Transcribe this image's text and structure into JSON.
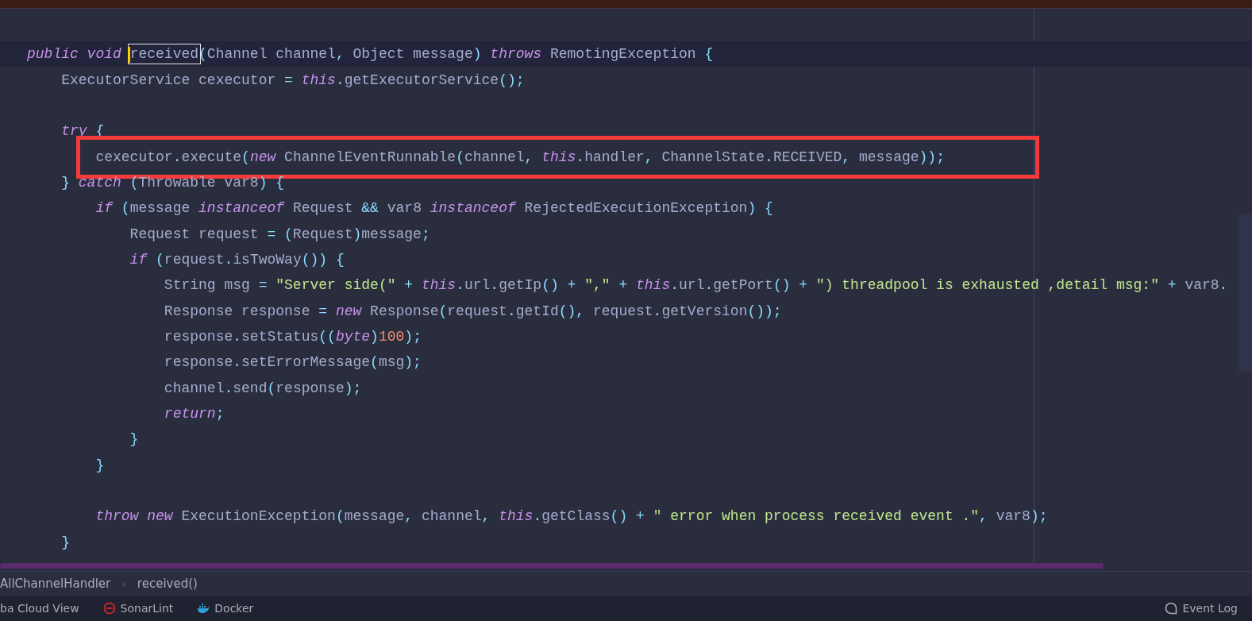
{
  "editor": {
    "lines": [
      {
        "current": true,
        "tokens": [
          {
            "kind": "kw",
            "text": "public void "
          },
          {
            "kind": "match",
            "text": "received"
          },
          {
            "kind": "p",
            "text": "("
          },
          {
            "kind": "id",
            "text": "Channel channel"
          },
          {
            "kind": "p",
            "text": ", "
          },
          {
            "kind": "id",
            "text": "Object message"
          },
          {
            "kind": "p",
            "text": ") "
          },
          {
            "kind": "kw",
            "text": "throws"
          },
          {
            "kind": "id",
            "text": " RemotingException "
          },
          {
            "kind": "p",
            "text": "{"
          }
        ]
      },
      {
        "tokens": [
          {
            "kind": "id",
            "text": "    ExecutorService cexecutor "
          },
          {
            "kind": "p",
            "text": "= "
          },
          {
            "kind": "kw",
            "text": "this"
          },
          {
            "kind": "p",
            "text": "."
          },
          {
            "kind": "id",
            "text": "getExecutorService"
          },
          {
            "kind": "p",
            "text": "();"
          }
        ]
      },
      {
        "gap_before": true,
        "tokens": [
          {
            "kind": "kw",
            "text": "    try"
          },
          {
            "kind": "p",
            "text": " {"
          }
        ]
      },
      {
        "annotated": true,
        "tokens": [
          {
            "kind": "id",
            "text": "        cexecutor"
          },
          {
            "kind": "p",
            "text": "."
          },
          {
            "kind": "id",
            "text": "execute"
          },
          {
            "kind": "p",
            "text": "("
          },
          {
            "kind": "kw",
            "text": "new"
          },
          {
            "kind": "id",
            "text": " ChannelEventRunnable"
          },
          {
            "kind": "p",
            "text": "("
          },
          {
            "kind": "id",
            "text": "channel"
          },
          {
            "kind": "p",
            "text": ", "
          },
          {
            "kind": "kw",
            "text": "this"
          },
          {
            "kind": "p",
            "text": "."
          },
          {
            "kind": "id",
            "text": "handler"
          },
          {
            "kind": "p",
            "text": ", "
          },
          {
            "kind": "id",
            "text": "ChannelState"
          },
          {
            "kind": "p",
            "text": "."
          },
          {
            "kind": "id",
            "text": "RECEIVED"
          },
          {
            "kind": "p",
            "text": ", "
          },
          {
            "kind": "id",
            "text": "message"
          },
          {
            "kind": "p",
            "text": "));"
          }
        ]
      },
      {
        "tokens": [
          {
            "kind": "p",
            "text": "    } "
          },
          {
            "kind": "kw",
            "text": "catch"
          },
          {
            "kind": "p",
            "text": " ("
          },
          {
            "kind": "id",
            "text": "Throwable var8"
          },
          {
            "kind": "p",
            "text": ") {"
          }
        ]
      },
      {
        "tokens": [
          {
            "kind": "kw",
            "text": "        if"
          },
          {
            "kind": "p",
            "text": " ("
          },
          {
            "kind": "id",
            "text": "message "
          },
          {
            "kind": "kw",
            "text": "instanceof"
          },
          {
            "kind": "id",
            "text": " Request "
          },
          {
            "kind": "p",
            "text": "&&"
          },
          {
            "kind": "id",
            "text": " var8 "
          },
          {
            "kind": "kw",
            "text": "instanceof"
          },
          {
            "kind": "id",
            "text": " RejectedExecutionException"
          },
          {
            "kind": "p",
            "text": ") {"
          }
        ]
      },
      {
        "tokens": [
          {
            "kind": "id",
            "text": "            Request request "
          },
          {
            "kind": "p",
            "text": "= ("
          },
          {
            "kind": "id",
            "text": "Request"
          },
          {
            "kind": "p",
            "text": ")"
          },
          {
            "kind": "id",
            "text": "message"
          },
          {
            "kind": "p",
            "text": ";"
          }
        ]
      },
      {
        "tokens": [
          {
            "kind": "kw",
            "text": "            if"
          },
          {
            "kind": "p",
            "text": " ("
          },
          {
            "kind": "id",
            "text": "request"
          },
          {
            "kind": "p",
            "text": "."
          },
          {
            "kind": "id",
            "text": "isTwoWay"
          },
          {
            "kind": "p",
            "text": "()) {"
          }
        ]
      },
      {
        "tokens": [
          {
            "kind": "id",
            "text": "                String msg "
          },
          {
            "kind": "p",
            "text": "= "
          },
          {
            "kind": "s",
            "text": "\"Server side(\""
          },
          {
            "kind": "p",
            "text": " + "
          },
          {
            "kind": "kw",
            "text": "this"
          },
          {
            "kind": "p",
            "text": "."
          },
          {
            "kind": "id",
            "text": "url"
          },
          {
            "kind": "p",
            "text": "."
          },
          {
            "kind": "id",
            "text": "getIp"
          },
          {
            "kind": "p",
            "text": "() + "
          },
          {
            "kind": "s",
            "text": "\",\""
          },
          {
            "kind": "p",
            "text": " + "
          },
          {
            "kind": "kw",
            "text": "this"
          },
          {
            "kind": "p",
            "text": "."
          },
          {
            "kind": "id",
            "text": "url"
          },
          {
            "kind": "p",
            "text": "."
          },
          {
            "kind": "id",
            "text": "getPort"
          },
          {
            "kind": "p",
            "text": "() + "
          },
          {
            "kind": "s",
            "text": "\") threadpool is exhausted ,detail msg:\""
          },
          {
            "kind": "p",
            "text": " + "
          },
          {
            "kind": "id",
            "text": "var8"
          },
          {
            "kind": "p",
            "text": "."
          }
        ]
      },
      {
        "tokens": [
          {
            "kind": "id",
            "text": "                Response response "
          },
          {
            "kind": "p",
            "text": "= "
          },
          {
            "kind": "kw",
            "text": "new"
          },
          {
            "kind": "id",
            "text": " Response"
          },
          {
            "kind": "p",
            "text": "("
          },
          {
            "kind": "id",
            "text": "request"
          },
          {
            "kind": "p",
            "text": "."
          },
          {
            "kind": "id",
            "text": "getId"
          },
          {
            "kind": "p",
            "text": "(), "
          },
          {
            "kind": "id",
            "text": "request"
          },
          {
            "kind": "p",
            "text": "."
          },
          {
            "kind": "id",
            "text": "getVersion"
          },
          {
            "kind": "p",
            "text": "());"
          }
        ]
      },
      {
        "tokens": [
          {
            "kind": "id",
            "text": "                response"
          },
          {
            "kind": "p",
            "text": "."
          },
          {
            "kind": "id",
            "text": "setStatus"
          },
          {
            "kind": "p",
            "text": "(("
          },
          {
            "kind": "kw",
            "text": "byte"
          },
          {
            "kind": "p",
            "text": ")"
          },
          {
            "kind": "n",
            "text": "100"
          },
          {
            "kind": "p",
            "text": ");"
          }
        ]
      },
      {
        "tokens": [
          {
            "kind": "id",
            "text": "                response"
          },
          {
            "kind": "p",
            "text": "."
          },
          {
            "kind": "id",
            "text": "setErrorMessage"
          },
          {
            "kind": "p",
            "text": "("
          },
          {
            "kind": "id",
            "text": "msg"
          },
          {
            "kind": "p",
            "text": ");"
          }
        ]
      },
      {
        "tokens": [
          {
            "kind": "id",
            "text": "                channel"
          },
          {
            "kind": "p",
            "text": "."
          },
          {
            "kind": "id",
            "text": "send"
          },
          {
            "kind": "p",
            "text": "("
          },
          {
            "kind": "id",
            "text": "response"
          },
          {
            "kind": "p",
            "text": ");"
          }
        ]
      },
      {
        "tokens": [
          {
            "kind": "kw",
            "text": "                return"
          },
          {
            "kind": "p",
            "text": ";"
          }
        ]
      },
      {
        "tokens": [
          {
            "kind": "p",
            "text": "            }"
          }
        ]
      },
      {
        "tokens": [
          {
            "kind": "p",
            "text": "        }"
          }
        ]
      },
      {
        "gap_before": true,
        "tokens": [
          {
            "kind": "kw",
            "text": "        throw new"
          },
          {
            "kind": "id",
            "text": " ExecutionException"
          },
          {
            "kind": "p",
            "text": "("
          },
          {
            "kind": "id",
            "text": "message"
          },
          {
            "kind": "p",
            "text": ", "
          },
          {
            "kind": "id",
            "text": "channel"
          },
          {
            "kind": "p",
            "text": ", "
          },
          {
            "kind": "kw",
            "text": "this"
          },
          {
            "kind": "p",
            "text": "."
          },
          {
            "kind": "id",
            "text": "getClass"
          },
          {
            "kind": "p",
            "text": "() + "
          },
          {
            "kind": "s",
            "text": "\" error when process received event .\""
          },
          {
            "kind": "p",
            "text": ", "
          },
          {
            "kind": "id",
            "text": "var8"
          },
          {
            "kind": "p",
            "text": ");"
          }
        ]
      },
      {
        "tokens": [
          {
            "kind": "p",
            "text": "    }"
          }
        ]
      }
    ]
  },
  "breadcrumbs": {
    "separator": "›",
    "items": [
      "AllChannelHandler",
      "received()"
    ]
  },
  "status_bar": {
    "left": [
      {
        "kind": "plain",
        "label": "ba Cloud View"
      },
      {
        "kind": "no-entry",
        "label": "SonarLint"
      },
      {
        "kind": "whale",
        "label": "Docker"
      }
    ],
    "right": [
      {
        "kind": "bubble",
        "label": "Event Log"
      }
    ]
  }
}
